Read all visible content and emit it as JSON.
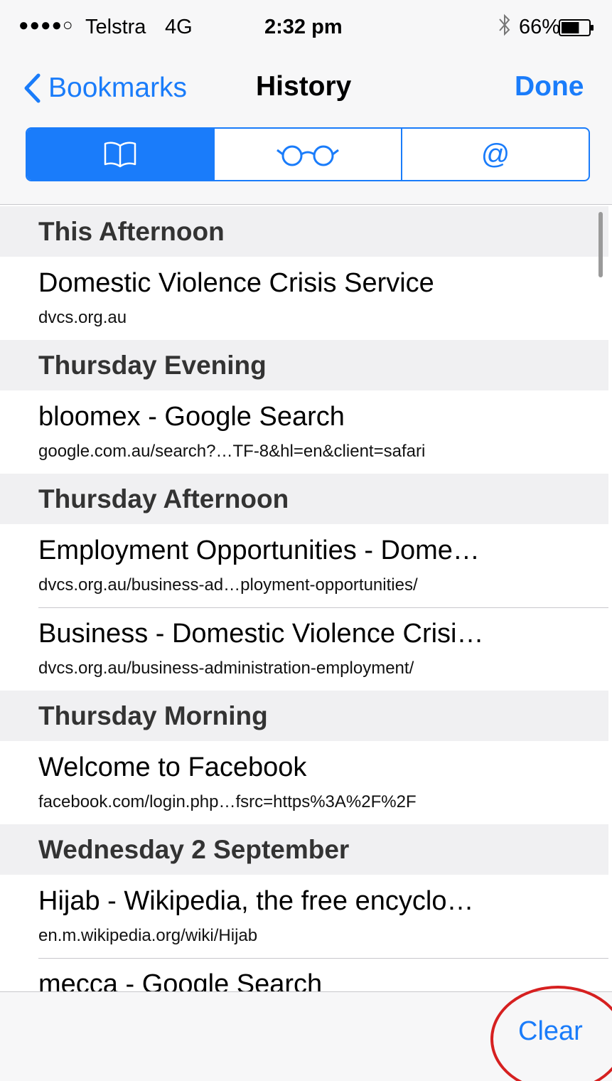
{
  "status_bar": {
    "signal": "●●●●○",
    "carrier": "Telstra",
    "network": "4G",
    "time": "2:32 pm",
    "bluetooth_icon": "bluetooth-icon",
    "battery_percent": "66%",
    "battery_level": 0.66
  },
  "nav": {
    "back_label": "Bookmarks",
    "title": "History",
    "done_label": "Done"
  },
  "segments": [
    {
      "icon": "book-icon",
      "selected": true
    },
    {
      "icon": "glasses-icon",
      "selected": false
    },
    {
      "icon": "at-sign-icon",
      "label": "@",
      "selected": false
    }
  ],
  "history": {
    "sections": [
      {
        "header": "This Afternoon",
        "items": [
          {
            "title": "Domestic Violence Crisis Service",
            "url": "dvcs.org.au"
          }
        ]
      },
      {
        "header": "Thursday Evening",
        "items": [
          {
            "title": "bloomex - Google Search",
            "url": "google.com.au/search?…TF-8&hl=en&client=safari"
          }
        ]
      },
      {
        "header": "Thursday Afternoon",
        "items": [
          {
            "title": "Employment Opportunities - Dome…",
            "url": "dvcs.org.au/business-ad…ployment-opportunities/"
          },
          {
            "title": "Business - Domestic Violence Crisi…",
            "url": "dvcs.org.au/business-administration-employment/"
          }
        ]
      },
      {
        "header": "Thursday Morning",
        "items": [
          {
            "title": "Welcome to Facebook",
            "url": "facebook.com/login.php…fsrc=https%3A%2F%2F"
          }
        ]
      },
      {
        "header": "Wednesday 2 September",
        "items": [
          {
            "title": "Hijab - Wikipedia, the free encyclo…",
            "url": "en.m.wikipedia.org/wiki/Hijab"
          },
          {
            "title": "mecca - Google Search",
            "url": ""
          }
        ]
      }
    ]
  },
  "toolbar": {
    "clear_label": "Clear"
  },
  "colors": {
    "accent": "#1a7cfa",
    "annotation": "#d62020"
  }
}
